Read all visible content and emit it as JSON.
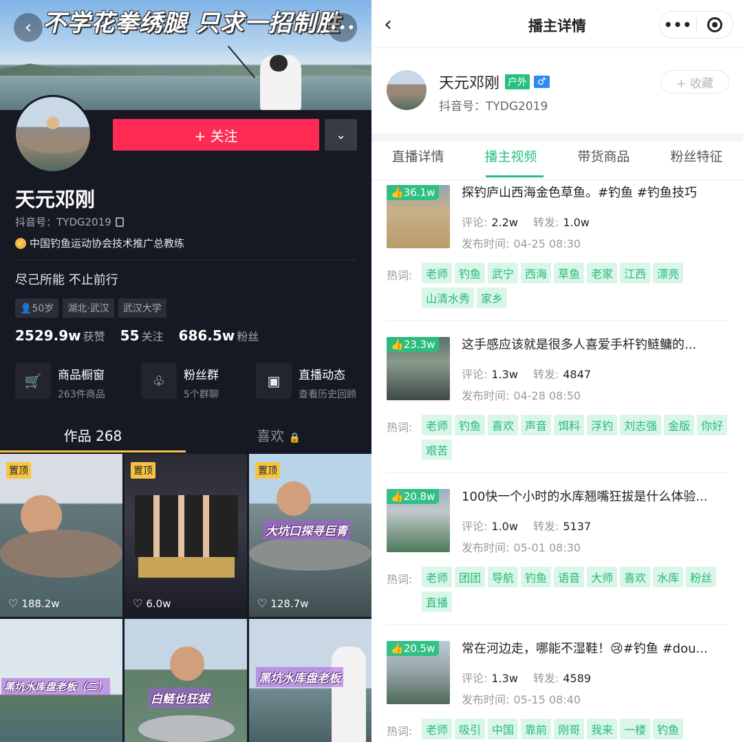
{
  "left": {
    "cover_title": "不学花拳绣腿  只求一招制胜",
    "name": "天元邓刚",
    "douyin_id": "抖音号：TYDG2019",
    "verification": "中国钓鱼运动协会技术推广总教练",
    "bio": "尽己所能 不止前行",
    "tags": [
      "50岁",
      "湖北·武汉",
      "武汉大学"
    ],
    "follow_label": "+ 关注",
    "stats": [
      {
        "num": "2529.9w",
        "label": "获赞"
      },
      {
        "num": "55",
        "label": "关注"
      },
      {
        "num": "686.5w",
        "label": "粉丝"
      }
    ],
    "features": [
      {
        "title": "商品橱窗",
        "sub": "263件商品"
      },
      {
        "title": "粉丝群",
        "sub": "5个群聊"
      },
      {
        "title": "直播动态",
        "sub": "查看历史回顾"
      }
    ],
    "tabs": [
      "作品 268",
      "喜欢"
    ],
    "grid": [
      {
        "pin": "置顶",
        "likes": "188.2w",
        "caption": ""
      },
      {
        "pin": "置顶",
        "likes": "6.0w",
        "caption": ""
      },
      {
        "pin": "置顶",
        "likes": "128.7w",
        "caption": "大坑口探寻巨青"
      },
      {
        "pin": "",
        "likes": "",
        "caption": "黑坑水库盘老板（二）"
      },
      {
        "pin": "",
        "likes": "",
        "caption": "白鲢也狂拔"
      },
      {
        "pin": "",
        "likes": "",
        "caption": "黑坑水库盘老板"
      }
    ]
  },
  "right": {
    "nav_title": "播主详情",
    "name": "天元邓刚",
    "badge_outdoor": "户外",
    "badge_gender": "♂",
    "douyin_id": "抖音号：TYDG2019",
    "collect_label": "+ 收藏",
    "tabs": [
      "直播详情",
      "播主视频",
      "带货商品",
      "粉丝特征"
    ],
    "active_tab": "播主视频",
    "comment_label": "评论:",
    "share_label": "转发:",
    "date_label": "发布时间:",
    "hot_label": "热词:",
    "videos": [
      {
        "likes": "36.1w",
        "title": "探钓庐山西海金色草鱼。#钓鱼 #钓鱼技巧",
        "comments": "2.2w",
        "shares": "1.0w",
        "date": "04-25 08:30",
        "keywords": [
          "老师",
          "钓鱼",
          "武宁",
          "西海",
          "草鱼",
          "老家",
          "江西",
          "漂亮",
          "山清水秀",
          "家乡"
        ]
      },
      {
        "likes": "23.3w",
        "title": "这手感应该就是很多人喜爱手杆钓鲢鳙的...",
        "comments": "1.3w",
        "shares": "4847",
        "date": "04-28 08:50",
        "keywords": [
          "老师",
          "钓鱼",
          "喜欢",
          "声音",
          "饵料",
          "浮钓",
          "刘志强",
          "金版",
          "你好",
          "艰苦"
        ]
      },
      {
        "likes": "20.8w",
        "title": "100快一个小时的水库翘嘴狂拔是什么体验...",
        "comments": "1.0w",
        "shares": "5137",
        "date": "05-01 08:30",
        "keywords": [
          "老师",
          "团团",
          "导航",
          "钓鱼",
          "语音",
          "大师",
          "喜欢",
          "水库",
          "粉丝",
          "直播"
        ]
      },
      {
        "likes": "20.5w",
        "title": "常在河边走，哪能不湿鞋！😢#钓鱼 #dou...",
        "comments": "1.3w",
        "shares": "4589",
        "date": "05-15 08:40",
        "keywords": [
          "老师",
          "吸引",
          "中国",
          "靠前",
          "刚哥",
          "我来",
          "一楼",
          "钓鱼"
        ]
      }
    ]
  }
}
